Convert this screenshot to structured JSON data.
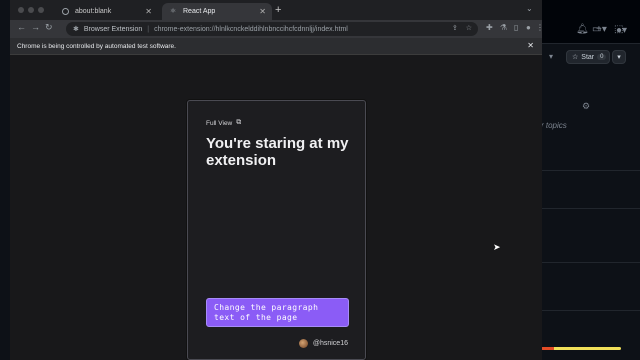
{
  "browser": {
    "tabs": [
      {
        "title": "about:blank",
        "active": false
      },
      {
        "title": "React App",
        "active": true
      }
    ],
    "new_tab": "+",
    "url_label": "Browser Extension",
    "url": "chrome-extension://hlnlkcnckelddihlnbnccihcfcdnnljj/index.html",
    "infobar_text": "Chrome is being controlled by automated test software."
  },
  "popup": {
    "full_view_label": "Full View",
    "headline": "You're staring at my extension",
    "button_label": "Change the paragraph text of the page",
    "username": "@hsnice16",
    "accent_color": "#8b5cf6"
  },
  "background": {
    "star_label": "Star",
    "star_count": "0",
    "topics_text": "r topics"
  }
}
